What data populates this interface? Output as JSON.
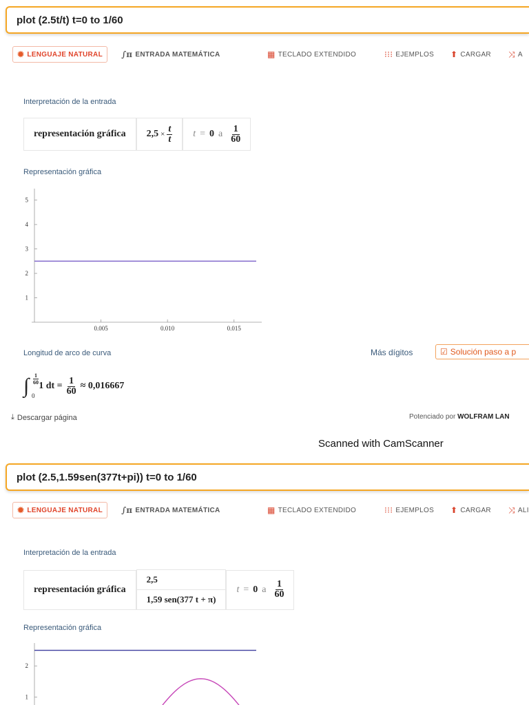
{
  "panel1": {
    "query": "plot (2.5t/t) t=0 to 1/60",
    "toolbar": {
      "natural": "LENGUAJE NATURAL",
      "math": "ENTRADA MATEMÁTICA",
      "keyboard": "TECLADO EXTENDIDO",
      "examples": "EJEMPLOS",
      "upload": "CARGAR",
      "random": "A"
    },
    "interpretation_title": "Interpretación de la entrada",
    "interp": {
      "label": "representación gráfica",
      "coef": "2,5",
      "num": "t",
      "den": "t",
      "tvar": "t",
      "eq": "=",
      "start": "0",
      "to": "a",
      "frac_num": "1",
      "frac_den": "60"
    },
    "plot_title": "Representación gráfica",
    "arc_title": "Longitud de arco de curva",
    "more_digits": "Más dígitos",
    "step_button": "Solución paso a p",
    "integral": {
      "upper_num": "1",
      "upper_den": "60",
      "lower": "0",
      "body": "1 dt =",
      "res_num": "1",
      "res_den": "60",
      "approx": "≈ 0,016667"
    },
    "download": "Descargar página",
    "powered_prefix": "Potenciado por",
    "powered_brand": "WOLFRAM LAN"
  },
  "scanned": "Scanned with CamScanner",
  "panel2": {
    "query": "plot (2.5,1.59sen(377t+pi)) t=0 to 1/60",
    "toolbar": {
      "natural": "LENGUAJE NATURAL",
      "math": "ENTRADA MATEMÁTICA",
      "keyboard": "TECLADO EXTENDIDO",
      "examples": "EJEMPLOS",
      "upload": "CARGAR",
      "random": "ALI"
    },
    "interpretation_title": "Interpretación de la entrada",
    "interp": {
      "label": "representación gráfica",
      "line1": "2,5",
      "line2": "1,59 sen(377 t + π)",
      "tvar": "t",
      "eq": "=",
      "start": "0",
      "to": "a",
      "frac_num": "1",
      "frac_den": "60"
    },
    "plot_title": "Representación gráfica"
  },
  "chart_data": [
    {
      "type": "line",
      "title": "",
      "xlabel": "",
      "ylabel": "",
      "xlim": [
        0,
        0.01667
      ],
      "ylim": [
        0,
        5.3
      ],
      "xticks": [
        "0.005",
        "0.010",
        "0.015"
      ],
      "yticks": [
        "1",
        "2",
        "3",
        "4",
        "5"
      ],
      "series": [
        {
          "color": "#7b61c9",
          "x": [
            0,
            0.01667
          ],
          "y": [
            2.5,
            2.5
          ]
        }
      ]
    },
    {
      "type": "line",
      "title": "",
      "xlabel": "",
      "ylabel": "",
      "xlim": [
        0,
        0.01667
      ],
      "ylim": [
        0,
        2.6
      ],
      "yticks": [
        "1",
        "2"
      ],
      "series": [
        {
          "color": "#3d3d9e",
          "x": [
            0,
            0.01667
          ],
          "y": [
            2.5,
            2.5
          ]
        },
        {
          "color": "#c646b8",
          "expr": "1.59*sin(377t+pi)",
          "x": [
            0.00833,
            0.0125,
            0.01667
          ],
          "y": [
            0,
            1.59,
            0
          ]
        }
      ]
    }
  ],
  "colors": {
    "accent": "#f5a623",
    "natural": "#e0442a",
    "section": "#3a5a7a"
  },
  "icons": {
    "natural": "gear-icon",
    "math": "integral-icon",
    "keyboard": "keyboard-icon",
    "examples": "grid-icon",
    "upload": "upload-icon",
    "random": "shuffle-icon",
    "step": "checkbox-icon",
    "download": "download-icon"
  }
}
